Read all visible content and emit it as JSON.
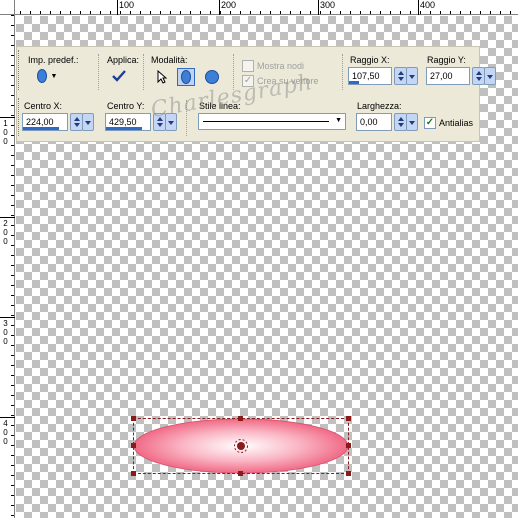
{
  "ruler": {
    "top_labels": [
      "100",
      "200",
      "300",
      "400"
    ],
    "left_labels": [
      [
        "1",
        "0",
        "0"
      ],
      [
        "2",
        "0",
        "0"
      ],
      [
        "3",
        "0",
        "0"
      ],
      [
        "4",
        "0",
        "0"
      ]
    ]
  },
  "palette": {
    "presets_label": "Imp. predef.:",
    "apply_label": "Applica:",
    "mode_label": "Modalità:",
    "show_nodes_label": "Mostra nodi",
    "create_vector_label": "Crea su vettore",
    "radius_x_label": "Raggio X:",
    "radius_x_value": "107,50",
    "radius_y_label": "Raggio Y:",
    "radius_y_value": "27,00",
    "center_x_label": "Centro X:",
    "center_x_value": "224,00",
    "center_y_label": "Centro Y:",
    "center_y_value": "429,50",
    "line_style_label": "Stile linea:",
    "width_label": "Larghezza:",
    "width_value": "0,00",
    "antialias_label": "Antialias",
    "apply_icon": "checkmark-icon",
    "preset_icon": "ellipse-icon"
  },
  "watermark": "Charlesgraph",
  "colors": {
    "accent": "#316ac5",
    "ellipse_center": "#ffffff",
    "ellipse_edge": "#f06a86",
    "selection": "#8b1a1a"
  }
}
